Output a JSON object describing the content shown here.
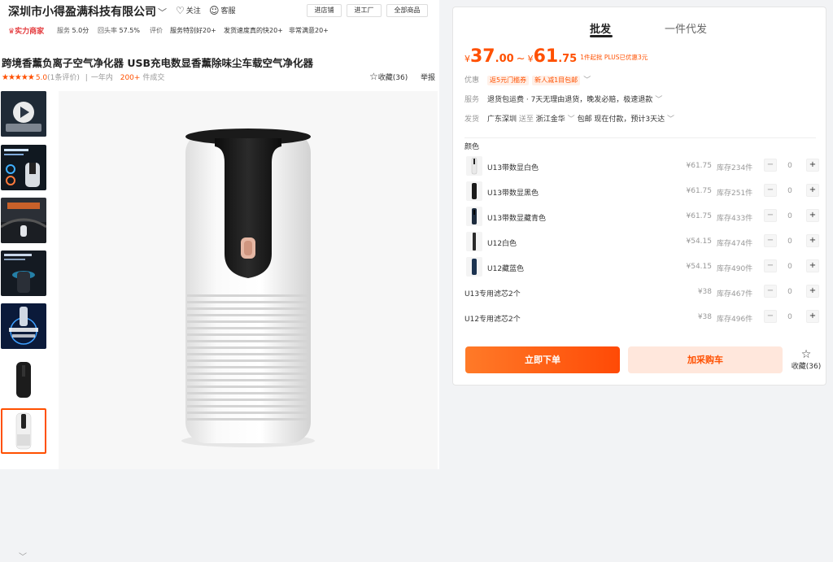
{
  "shop": {
    "name": "深圳市小得盈满科技有限公司",
    "follow_label": "关注",
    "service_label": "客服",
    "buttons": [
      "进店铺",
      "进工厂",
      "全部商品"
    ]
  },
  "shop_stats": {
    "badge": "实力商家",
    "service_label": "服务",
    "service_value": "5.0分",
    "repeat_label": "回头率",
    "repeat_value": "57.5%",
    "review_label": "评价",
    "review_items": [
      "服务特别好20+",
      "发货速度真的快20+",
      "非常满意20+"
    ]
  },
  "product": {
    "title": "跨境香薰负离子空气净化器 USB充电数显香薰除味尘车载空气净化器",
    "stars": "★★★★★",
    "score": "5.0",
    "reviews": "(1条评价)",
    "period": "一年内",
    "sold_count": "200+",
    "sold_label": "件成交",
    "favorite": "收藏(36)",
    "report": "举报"
  },
  "gallery": {
    "thumbnails": [
      "thumb-video",
      "thumb-dashboard",
      "thumb-car-interior",
      "thumb-car-cupholder",
      "thumb-360-purify",
      "thumb-black-unit",
      "thumb-white-unit"
    ],
    "active_index": 6
  },
  "purchase": {
    "tabs": [
      "批发",
      "一件代发"
    ],
    "active_tab": 0,
    "price_low_int": "37",
    "price_low_dec": ".00",
    "price_high_int": "61",
    "price_high_dec": ".75",
    "currency": "¥",
    "tilde": "~",
    "price_note": "1件起批 PLUS已优惠3元",
    "promo_label": "优惠",
    "coupons": [
      "返5元门槛券",
      "新人减1目包邮"
    ],
    "service_label": "服务",
    "service_text": "退货包运费 · 7天无理由退货，晚发必赔，极速退款",
    "ship_label": "发货",
    "ship_from": "广东深圳",
    "ship_to_label": "送至",
    "ship_to": "浙江金华",
    "ship_terms": "包邮  现在付款，预计3天达",
    "color_label": "颜色",
    "skus": [
      {
        "name": "U13带数显白色",
        "price": "¥61.75",
        "stock": "库存234件",
        "qty": "0",
        "thumb": "white"
      },
      {
        "name": "U13带数显黑色",
        "price": "¥61.75",
        "stock": "库存251件",
        "qty": "0",
        "thumb": "black"
      },
      {
        "name": "U13带数显藏青色",
        "price": "¥61.75",
        "stock": "库存433件",
        "qty": "0",
        "thumb": "navy"
      },
      {
        "name": "U12白色",
        "price": "¥54.15",
        "stock": "库存474件",
        "qty": "0",
        "thumb": "white-slim"
      },
      {
        "name": "U12藏蓝色",
        "price": "¥54.15",
        "stock": "库存490件",
        "qty": "0",
        "thumb": "navy-slim"
      },
      {
        "name": "U13专用滤芯2个",
        "price": "¥38",
        "stock": "库存467件",
        "qty": "0",
        "thumb": ""
      },
      {
        "name": "U12专用滤芯2个",
        "price": "¥38",
        "stock": "库存496件",
        "qty": "0",
        "thumb": ""
      }
    ],
    "order_button": "立即下单",
    "cart_button": "加采购车",
    "favorite": "收藏(36)"
  },
  "colors": {
    "accent": "#ff5000",
    "badge_red": "#e4393c"
  }
}
